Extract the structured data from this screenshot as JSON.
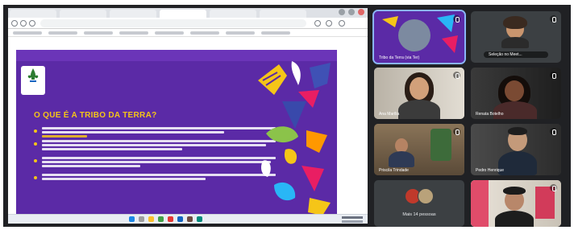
{
  "slide": {
    "title": "O QUE É A TRIBO DA TERRA?"
  },
  "participants": [
    {
      "name": "Tribo da Terra (via Ter)",
      "tile": "presenter",
      "speaking": true
    },
    {
      "name": "Seleção no Meet...",
      "tile": "small-self"
    },
    {
      "name": "Ana Marília",
      "tile": "woman-glasses"
    },
    {
      "name": "Renata Botelho",
      "tile": "woman-dark"
    },
    {
      "name": "Priscila Trindade",
      "tile": "man-room"
    },
    {
      "name": "Pedro Henrique",
      "tile": "man-dark"
    },
    {
      "name": "",
      "tile": "man-cap"
    }
  ],
  "others": {
    "label": "Mais 14 pessoas"
  },
  "colors": {
    "slide_bg": "#5b2aa6",
    "accent_yellow": "#f5c518",
    "meet_bg": "#202124",
    "tile_bg": "#3c4043",
    "speaking_outline": "#8ab4f8"
  }
}
